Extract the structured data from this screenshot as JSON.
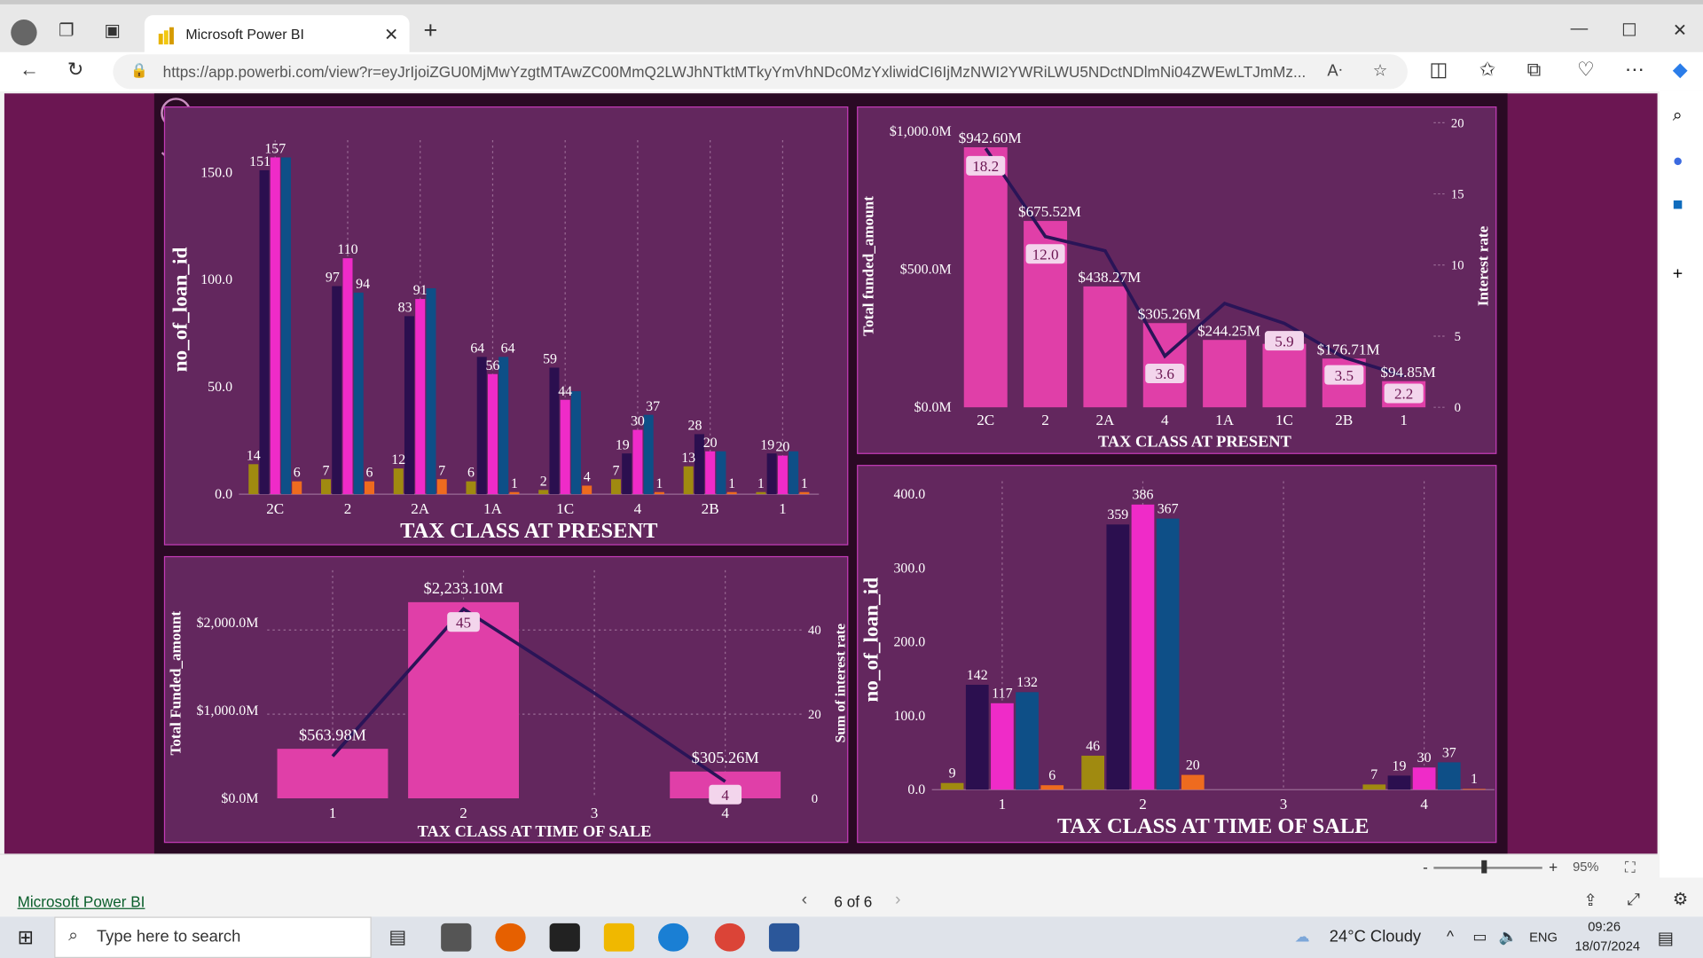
{
  "browser": {
    "tab_title": "Microsoft Power BI",
    "url": "https://app.powerbi.com/view?r=eyJrIjoiZGU0MjMwYzgtMTAwZC00MmQ2LWJhNTktMTkyYmVhNDc0MzYxliwidCI6IjMzNWI2YWRiLWU5NDctNDlmNi04ZWEwLTJmMz..."
  },
  "report": {
    "chart1": {
      "xlabel": "TAX CLASS AT PRESENT",
      "ylabel": "no_of_loan_id",
      "yticks": [
        "0.0",
        "50.0",
        "100.0",
        "150.0"
      ]
    },
    "chart2": {
      "xlabel": "TAX CLASS AT PRESENT",
      "ylabel": "Total funded_amount",
      "y2label": "Interest rate",
      "yticks": [
        "$0.0M",
        "$500.0M",
        "$1,000.0M"
      ],
      "y2ticks": [
        "0",
        "5",
        "10",
        "15",
        "20"
      ]
    },
    "chart3": {
      "xlabel": "TAX CLASS AT TIME OF SALE",
      "ylabel": "Total Funded_amount",
      "y2label": "Sum of interest rate",
      "yticks": [
        "$0.0M",
        "$1,000.0M",
        "$2,000.0M"
      ],
      "y2ticks": [
        "0",
        "20",
        "40"
      ]
    },
    "chart4": {
      "xlabel": "TAX CLASS AT TIME OF SALE",
      "ylabel": "no_of_loan_id",
      "yticks": [
        "0.0",
        "100.0",
        "200.0",
        "300.0",
        "400.0"
      ]
    },
    "colors": {
      "olive": "#a08a10",
      "navy": "#2b0f4f",
      "pink": "#ef2bc8",
      "blue": "#0e4f87",
      "orange": "#ee6b1f",
      "bar": "#e03fa8",
      "line": "#2a1457"
    }
  },
  "chart_data": [
    {
      "type": "bar",
      "categories": [
        "2C",
        "2",
        "2A",
        "1A",
        "1C",
        "4",
        "2B",
        "1"
      ],
      "series": [
        {
          "values": [
            14,
            7,
            12,
            6,
            2,
            7,
            13,
            1
          ]
        },
        {
          "values": [
            151,
            97,
            83,
            64,
            59,
            19,
            28,
            19
          ]
        },
        {
          "values": [
            157,
            110,
            91,
            56,
            44,
            30,
            20,
            18
          ]
        },
        {
          "values": [
            157,
            94,
            96,
            64,
            48,
            37,
            20,
            20
          ]
        },
        {
          "values": [
            6,
            6,
            7,
            1,
            4,
            1,
            1,
            1
          ]
        }
      ],
      "data_labels": [
        [
          "14",
          "151",
          "157",
          "6"
        ],
        [
          "7",
          "97",
          "110",
          "94",
          "6"
        ],
        [
          "12",
          "83",
          "91",
          "7"
        ],
        [
          "6",
          "64",
          "56",
          "64",
          "1"
        ],
        [
          "2",
          "59",
          "44",
          "4"
        ],
        [
          "7",
          "19",
          "30",
          "37",
          "1"
        ],
        [
          "13",
          "28",
          "20",
          "1"
        ],
        [
          "1",
          "19",
          "20",
          "1"
        ]
      ],
      "xlabel": "TAX CLASS AT PRESENT",
      "ylabel": "no_of_loan_id",
      "ylim": [
        0,
        160
      ]
    },
    {
      "type": "bar",
      "categories": [
        "2C",
        "2",
        "2A",
        "4",
        "1A",
        "1C",
        "2B",
        "1"
      ],
      "series": [
        {
          "values": [
            942.6,
            675.52,
            438.27,
            305.26,
            244.25,
            230,
            176.71,
            94.85
          ]
        },
        {
          "values": [
            18.2,
            12.0,
            11.0,
            3.6,
            7.3,
            5.9,
            3.5,
            2.2
          ]
        }
      ],
      "bar_labels": [
        "$942.60M",
        "$675.52M",
        "$438.27M",
        "$305.26M",
        "$244.25M",
        "",
        "$176.71M",
        "$94.85M"
      ],
      "line_labels": [
        "18.2",
        "12.0",
        "",
        "3.6",
        "",
        "5.9",
        "3.5",
        "2.2"
      ],
      "xlabel": "TAX CLASS AT PRESENT",
      "ylabel": "Total funded_amount",
      "y2label": "Interest rate",
      "ylim": [
        0,
        1000
      ],
      "y2lim": [
        0,
        20
      ]
    },
    {
      "type": "bar",
      "categories": [
        "1",
        "2",
        "3",
        "4"
      ],
      "series": [
        {
          "values": [
            563.98,
            2233.1,
            0,
            305.26
          ]
        },
        {
          "values": [
            10,
            45,
            25,
            4
          ]
        }
      ],
      "bar_labels": [
        "$563.98M",
        "$2,233.10M",
        "",
        "$305.26M"
      ],
      "line_labels": [
        "",
        "45",
        "",
        "4"
      ],
      "xlabel": "TAX CLASS AT TIME OF SALE",
      "ylabel": "Total Funded_amount",
      "y2label": "Sum of interest rate",
      "ylim": [
        0,
        2300
      ],
      "y2lim": [
        0,
        48
      ]
    },
    {
      "type": "bar",
      "categories": [
        "1",
        "2",
        "3",
        "4"
      ],
      "series": [
        {
          "values": [
            9,
            46,
            0,
            7
          ]
        },
        {
          "values": [
            142,
            359,
            0,
            19
          ]
        },
        {
          "values": [
            117,
            386,
            0,
            30
          ]
        },
        {
          "values": [
            132,
            367,
            0,
            37
          ]
        },
        {
          "values": [
            6,
            20,
            0,
            1
          ]
        }
      ],
      "data_labels": [
        [
          "9",
          "142",
          "117",
          "132",
          "6"
        ],
        [
          "46",
          "359",
          "386",
          "367",
          "20"
        ],
        [],
        [
          "7",
          "19",
          "30",
          "37",
          "1"
        ]
      ],
      "xlabel": "TAX CLASS AT TIME OF SALE",
      "ylabel": "no_of_loan_id",
      "ylim": [
        0,
        400
      ]
    }
  ],
  "pbi_footer": {
    "link": "Microsoft Power BI",
    "page": "6 of 6",
    "zoom": "95%"
  },
  "taskbar": {
    "search_placeholder": "Type here to search",
    "weather": "24°C  Cloudy",
    "lang": "ENG",
    "time": "09:26",
    "date": "18/07/2024"
  }
}
